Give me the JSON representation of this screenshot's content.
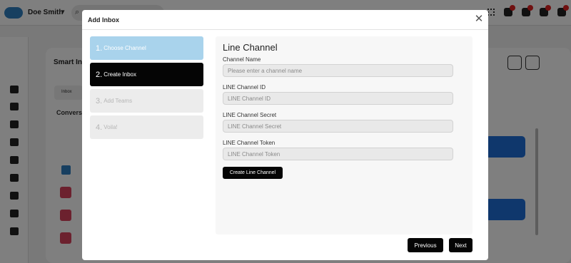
{
  "background_app": {
    "user_name": "Doe Smith",
    "smart_inbox_title": "Smart Inb",
    "inbox_tab": "Inbox",
    "conversations_label": "Convers"
  },
  "modal": {
    "title": "Add Inbox",
    "steps": [
      {
        "number": "1.",
        "label": "Choose Channel",
        "state": "done"
      },
      {
        "number": "2.",
        "label": "Create Inbox",
        "state": "active"
      },
      {
        "number": "3.",
        "label": "Add Teams",
        "state": "pending"
      },
      {
        "number": "4.",
        "label": "Voila!",
        "state": "pending"
      }
    ],
    "form": {
      "title": "Line Channel",
      "channel_name_label": "Channel Name",
      "channel_name_placeholder": "Please enter a channel name",
      "channel_id_label": "LINE Channel ID",
      "channel_id_placeholder": "LINE Channel ID",
      "channel_secret_label": "LINE Channel Secret",
      "channel_secret_placeholder": "LINE Channel Secret",
      "channel_token_label": "LINE Channel Token",
      "channel_token_placeholder": "LINE Channel Token",
      "create_button": "Create Line Channel"
    },
    "previous_button": "Previous",
    "next_button": "Next"
  },
  "colors": {
    "step_done": "#a9d3ec",
    "step_active": "#050505",
    "step_pending": "#ececec",
    "primary_button": "#050505"
  },
  "icons": {
    "close": "close-icon",
    "search": "search-icon",
    "chevron": "chevron-down-icon"
  }
}
